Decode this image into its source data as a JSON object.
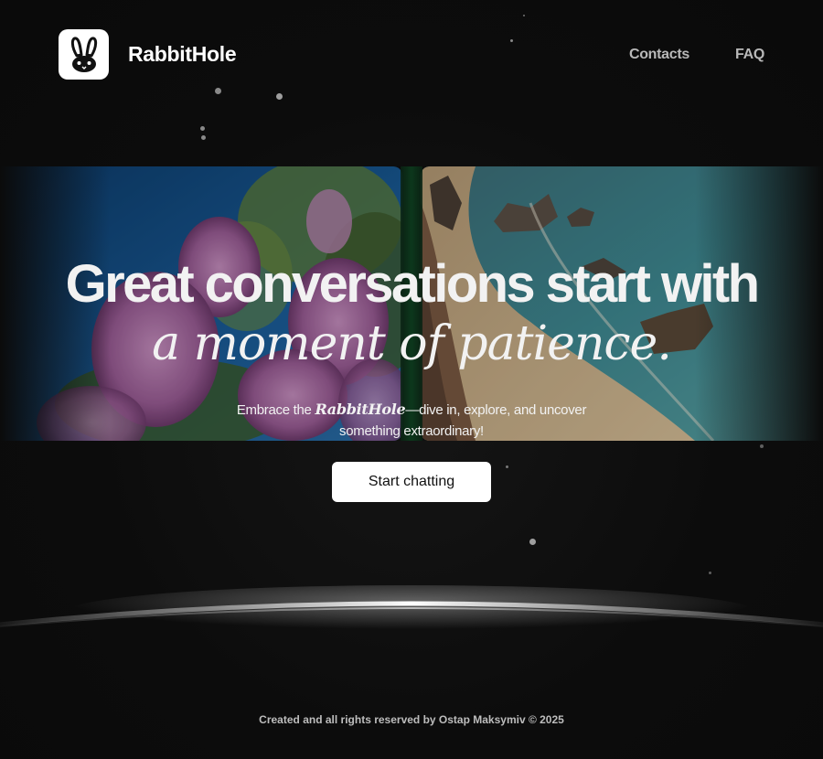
{
  "header": {
    "brand": "RabbitHole",
    "logo_icon": "rabbit-icon",
    "nav": [
      {
        "label": "Contacts"
      },
      {
        "label": "FAQ"
      }
    ]
  },
  "hero": {
    "headline": "Great conversations start with",
    "subhead": "a moment of patience.",
    "tagline_pre": "Embrace the ",
    "tagline_brand": "RabbitHole",
    "tagline_post": "—dive in, explore, and uncover something extraordinary!",
    "cta_label": "Start chatting"
  },
  "footer": {
    "text": "Created and all rights reserved by Ostap Maksymiv © 2025"
  },
  "colors": {
    "background": "#0b0b0b",
    "accent": "#ffffff",
    "nav_text": "#b8b8b8"
  }
}
